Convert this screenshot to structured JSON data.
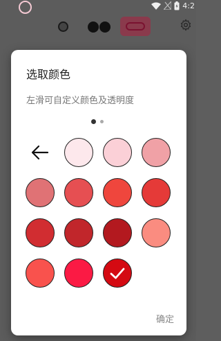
{
  "status_bar": {
    "time": "4:2"
  },
  "dialog": {
    "title": "选取颜色",
    "subtitle": "左滑可自定义颜色及透明度",
    "confirm_label": "确定",
    "page_count": 2,
    "current_page": 1
  },
  "back_icon": "arrow-left-icon",
  "swatches": [
    {
      "color": "#fde8ec",
      "selected": false
    },
    {
      "color": "#fbd0d7",
      "selected": false
    },
    {
      "color": "#f0a1a6",
      "selected": false
    },
    {
      "color": "#e07275",
      "selected": false
    },
    {
      "color": "#e64f52",
      "selected": false
    },
    {
      "color": "#ef463d",
      "selected": false
    },
    {
      "color": "#e53a38",
      "selected": false
    },
    {
      "color": "#d12d31",
      "selected": false
    },
    {
      "color": "#c1262b",
      "selected": false
    },
    {
      "color": "#b3191f",
      "selected": false
    },
    {
      "color": "#fa8c80",
      "selected": false
    },
    {
      "color": "#f9524d",
      "selected": false
    },
    {
      "color": "#fb1a44",
      "selected": false
    },
    {
      "color": "#d40a12",
      "selected": true
    }
  ],
  "colors": {
    "toolbar_active_bg": "#8a3a4c",
    "status_ring": "#f4c9d3"
  }
}
